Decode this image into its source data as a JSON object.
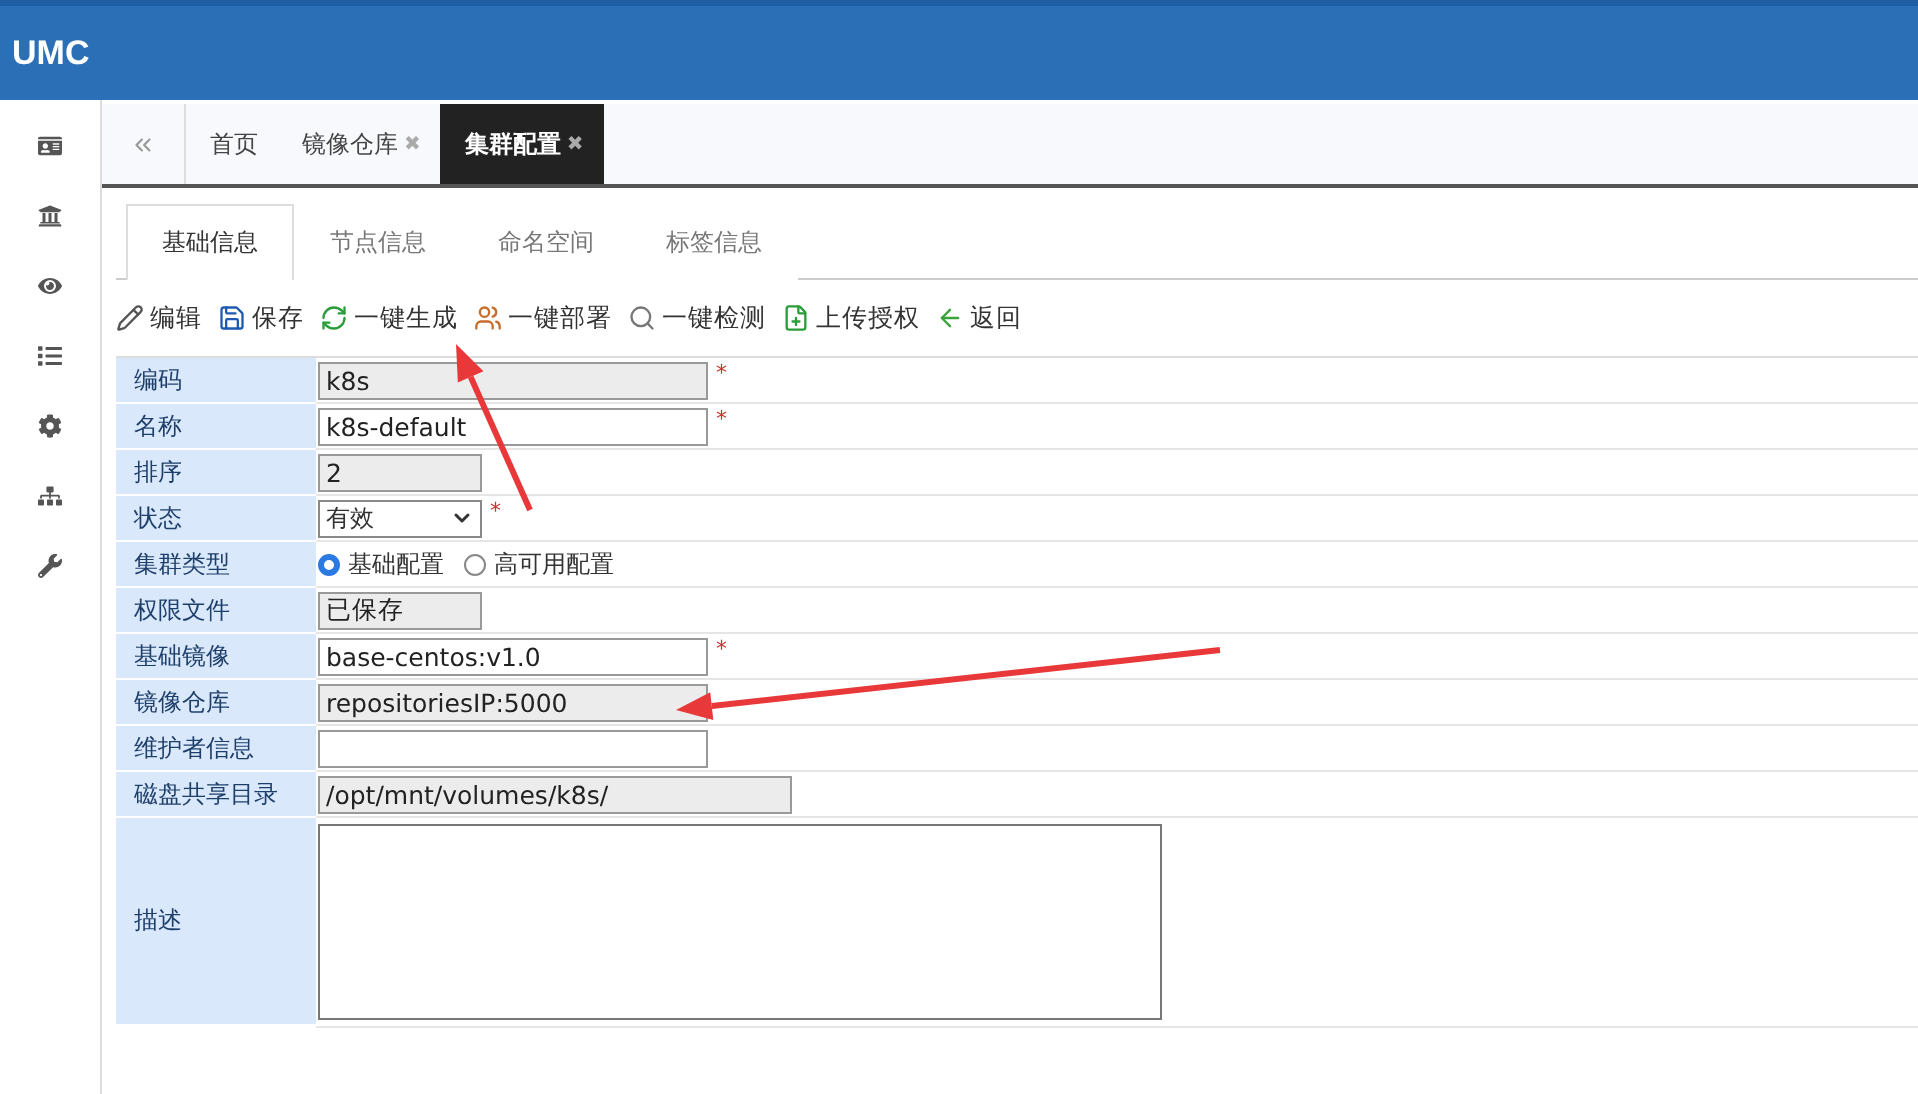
{
  "header": {
    "logo": "UMC"
  },
  "page_tabs": [
    {
      "label": "首页",
      "selected": false
    },
    {
      "label": "镜像仓库",
      "close": "✖",
      "selected": false
    },
    {
      "label": "集群配置",
      "close": "✖",
      "selected": true
    }
  ],
  "sub_tabs": [
    {
      "label": "基础信息",
      "selected": true
    },
    {
      "label": "节点信息",
      "selected": false
    },
    {
      "label": "命名空间",
      "selected": false
    },
    {
      "label": "标签信息",
      "selected": false
    }
  ],
  "toolbar": [
    {
      "label": "编辑"
    },
    {
      "label": "保存"
    },
    {
      "label": "一键生成"
    },
    {
      "label": "一键部署"
    },
    {
      "label": "一键检测"
    },
    {
      "label": "上传授权"
    },
    {
      "label": "返回"
    }
  ],
  "form": [
    {
      "label": "编码",
      "kind": "text",
      "value": "k8s",
      "readonly": true,
      "required_mark": "*"
    },
    {
      "label": "名称",
      "kind": "text",
      "value": "k8s-default",
      "readonly": false,
      "required_mark": "*"
    },
    {
      "label": "排序",
      "kind": "text",
      "value": "2",
      "readonly": true
    },
    {
      "label": "状态",
      "kind": "select",
      "value": "有效",
      "required_mark": "*"
    },
    {
      "label": "集群类型",
      "kind": "radio",
      "options": [
        {
          "label": "基础配置",
          "selected": true
        },
        {
          "label": "高可用配置",
          "selected": false
        }
      ]
    },
    {
      "label": "权限文件",
      "kind": "text",
      "value": "已保存",
      "readonly": true
    },
    {
      "label": "基础镜像",
      "kind": "text",
      "value": "base-centos:v1.0",
      "readonly": false,
      "required_mark": "*"
    },
    {
      "label": "镜像仓库",
      "kind": "text",
      "value": "repositoriesIP:5000",
      "readonly": true
    },
    {
      "label": "维护者信息",
      "kind": "text",
      "readonly": false
    },
    {
      "label": "磁盘共享目录",
      "kind": "text",
      "value": "/opt/mnt/volumes/k8s/",
      "readonly": true
    },
    {
      "label": "描述",
      "kind": "textarea"
    }
  ],
  "annotations": [
    {
      "kind": "arrow"
    },
    {
      "kind": "arrow"
    }
  ]
}
